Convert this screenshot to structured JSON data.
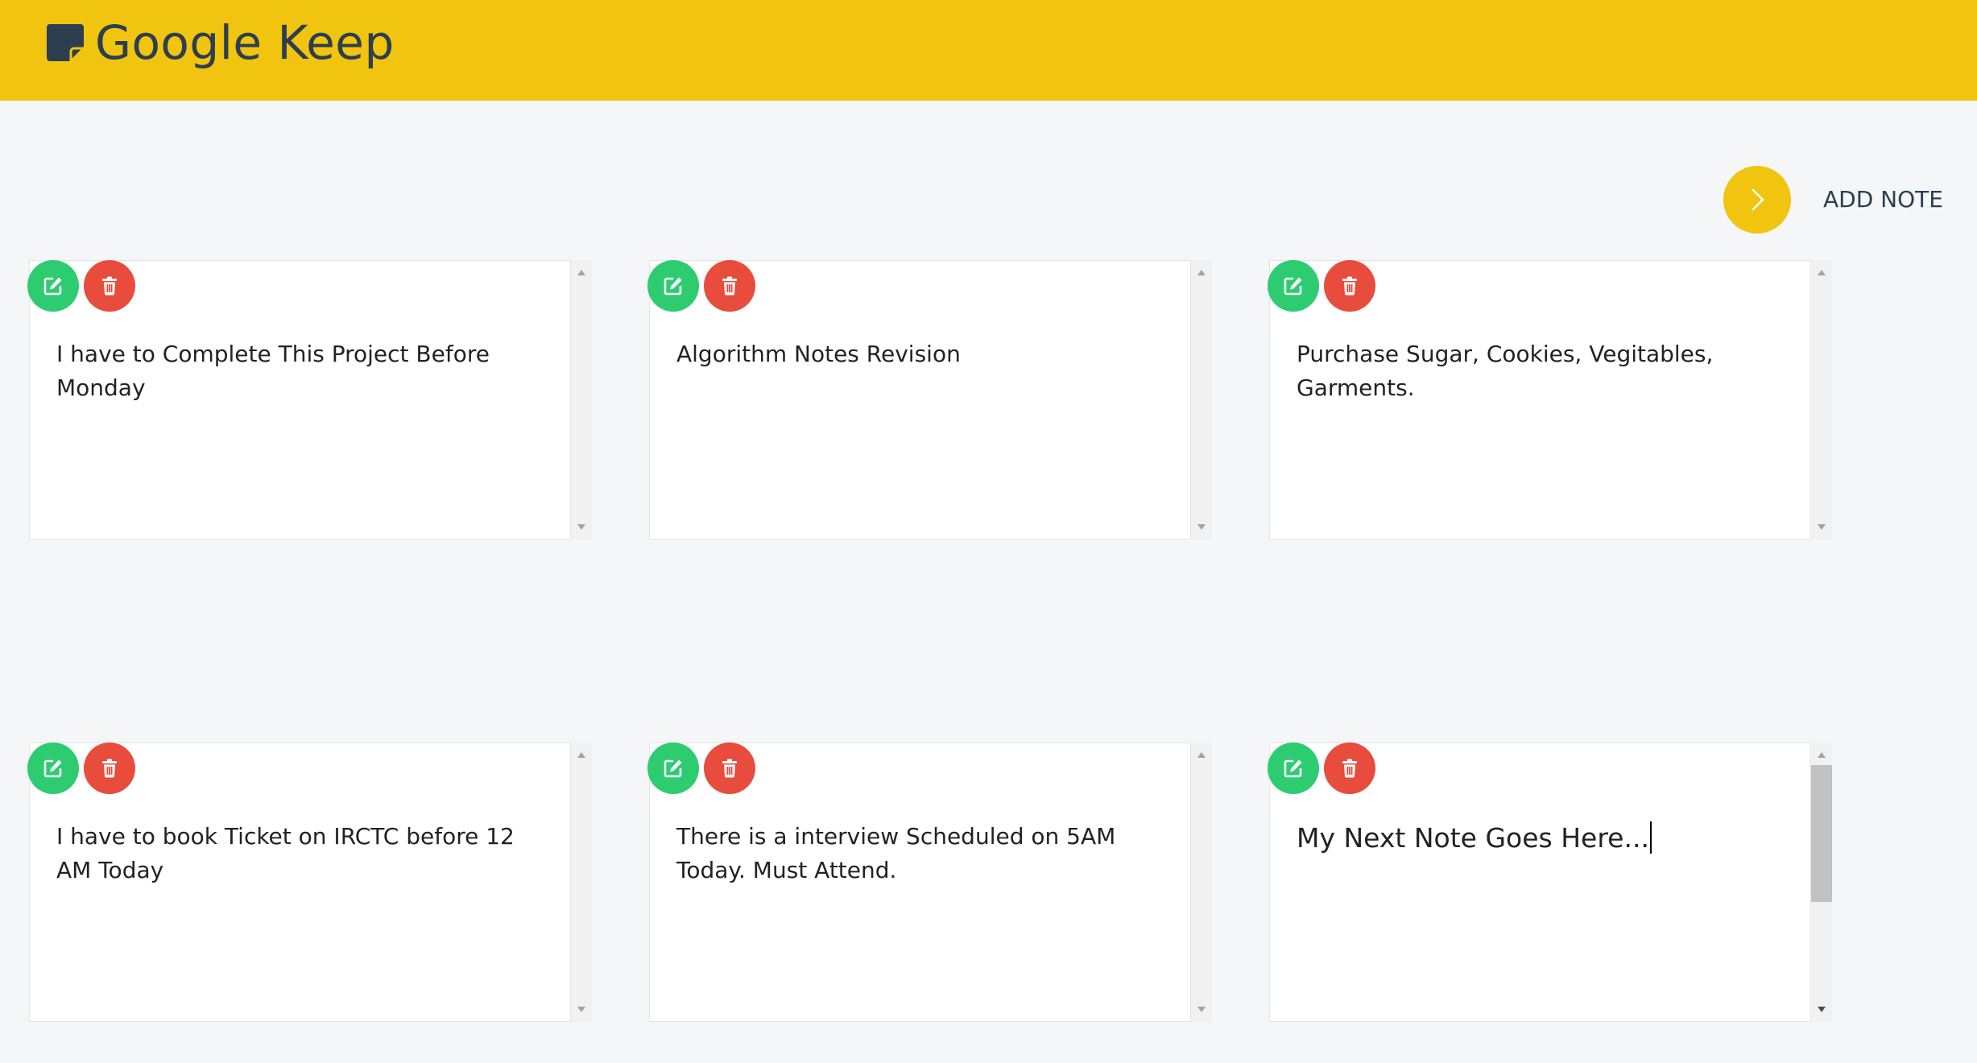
{
  "header": {
    "app_title": "Google Keep",
    "logo_icon": "sticky-note-icon",
    "background_color": "#f1c40f"
  },
  "toolbar": {
    "add_button_icon": "chevron-right-icon",
    "add_label": "ADD NOTE"
  },
  "notes": [
    {
      "text": "I have to Complete This Project Before Monday"
    },
    {
      "text": "Algorithm Notes Revision"
    },
    {
      "text": "Purchase Sugar, Cookies, Vegitables, Garments."
    },
    {
      "text": "I have to book Ticket on IRCTC before 12 AM Today"
    },
    {
      "text": "There is a interview Scheduled on 5AM Today. Must Attend."
    },
    {
      "text": "My Next Note Goes Here..."
    }
  ],
  "note_actions": {
    "edit_icon": "edit-icon",
    "delete_icon": "trash-icon",
    "edit_color": "#2ecc71",
    "delete_color": "#e74c3c"
  }
}
